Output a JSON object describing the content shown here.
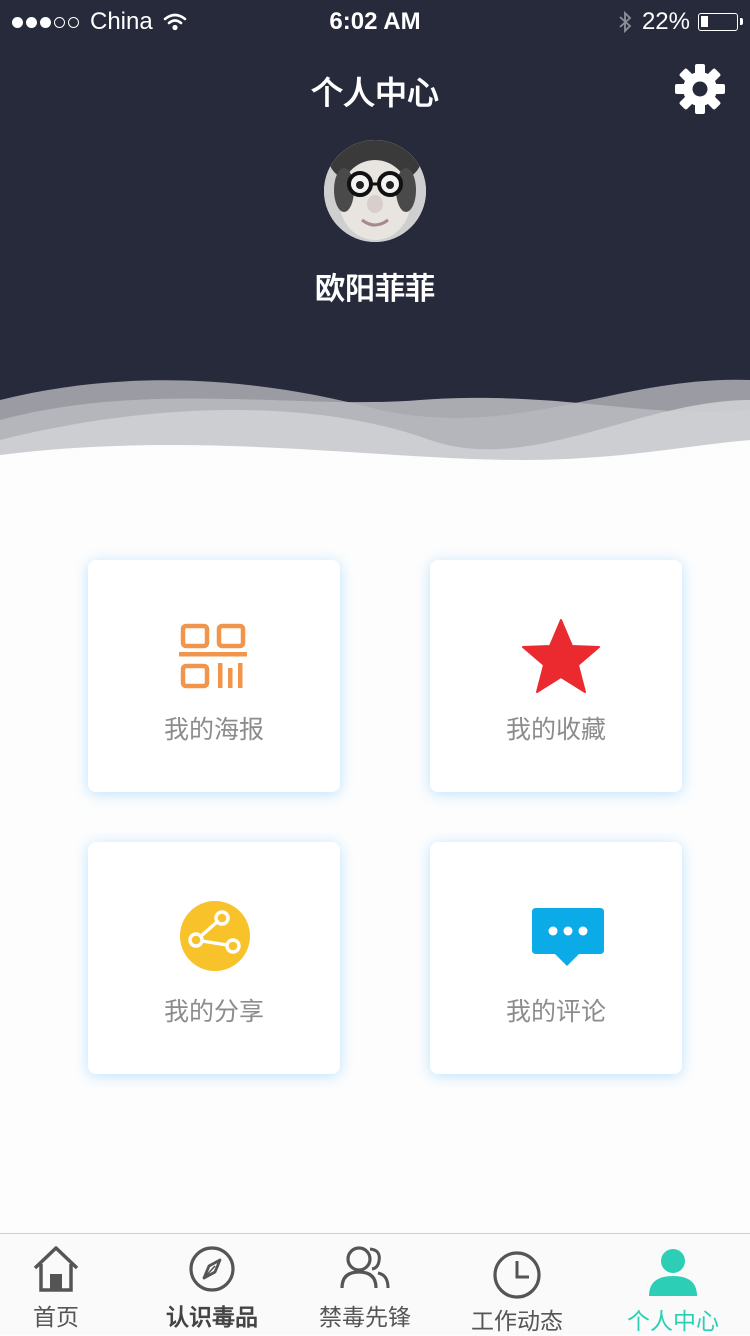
{
  "status_bar": {
    "carrier": "China",
    "time": "6:02 AM",
    "battery": "22%",
    "battery_level": 0.22
  },
  "header": {
    "title": "个人中心",
    "settings_icon": "gear-icon",
    "username": "欧阳菲菲"
  },
  "cards": [
    {
      "label": "我的海报",
      "icon": "qr-code-icon",
      "color": "#f0954b"
    },
    {
      "label": "我的收藏",
      "icon": "star-icon",
      "color": "#ea2a2f"
    },
    {
      "label": "我的分享",
      "icon": "share-icon",
      "color": "#f8c22a"
    },
    {
      "label": "我的评论",
      "icon": "comment-icon",
      "color": "#0aabe7"
    }
  ],
  "tabbar": {
    "items": [
      {
        "label": "首页",
        "icon": "home-icon"
      },
      {
        "label": "认识毒品",
        "icon": "compass-icon"
      },
      {
        "label": "禁毒先锋",
        "icon": "users-icon"
      },
      {
        "label": "工作动态",
        "icon": "clock-icon"
      },
      {
        "label": "个人中心",
        "icon": "person-icon"
      }
    ],
    "active_index": 4,
    "active_color": "#2ccfb6"
  },
  "colors": {
    "header_bg": "#272a3b",
    "page_bg": "#fdfdfd"
  }
}
